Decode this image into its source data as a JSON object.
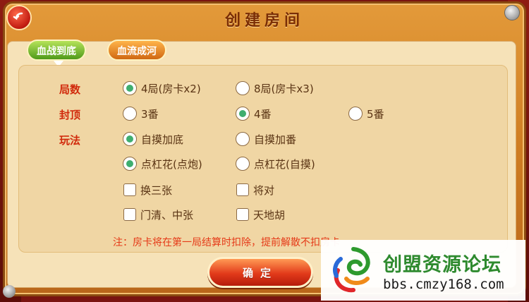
{
  "dialog": {
    "title": "创建房间"
  },
  "tabs": [
    {
      "label": "血战到底",
      "active": true
    },
    {
      "label": "血流成河",
      "active": false
    }
  ],
  "rows": {
    "rounds": {
      "label": "局数",
      "options": [
        {
          "label": "4局(房卡x2)",
          "selected": true
        },
        {
          "label": "8局(房卡x3)",
          "selected": false
        }
      ]
    },
    "cap": {
      "label": "封顶",
      "options": [
        {
          "label": "3番",
          "selected": false
        },
        {
          "label": "4番",
          "selected": true
        },
        {
          "label": "5番",
          "selected": false
        }
      ]
    },
    "play": {
      "label": "玩法",
      "options": [
        {
          "label": "自摸加底",
          "selected": true
        },
        {
          "label": "自摸加番",
          "selected": false
        }
      ]
    },
    "kong": {
      "options": [
        {
          "label": "点杠花(点炮)",
          "selected": true
        },
        {
          "label": "点杠花(自摸)",
          "selected": false
        }
      ]
    },
    "extras1": {
      "options": [
        {
          "label": "换三张",
          "checked": false
        },
        {
          "label": "将对",
          "checked": false
        }
      ]
    },
    "extras2": {
      "options": [
        {
          "label": "门清、中张",
          "checked": false
        },
        {
          "label": "天地胡",
          "checked": false
        }
      ]
    }
  },
  "note": "注：房卡将在第一局结算时扣除，提前解散不扣房卡",
  "confirm_label": "确定",
  "watermark": {
    "title": "创盟资源论坛",
    "url": "bbs.cmzy168.com"
  },
  "colors": {
    "accent": "#3fae6f",
    "label": "#d12a0c",
    "note": "#e53a18"
  }
}
